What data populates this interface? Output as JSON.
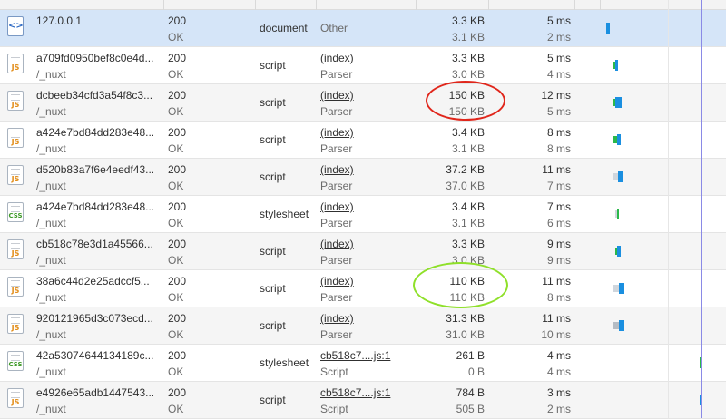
{
  "colors": {
    "selected_row": "#d5e5f8",
    "bar_blue": "#1a8fe0",
    "bar_green": "#2bb84a",
    "red_annotation": "#e0261b",
    "green_annotation": "#8fe02a"
  },
  "rows": [
    {
      "icon": "html-document-icon",
      "type_label": "<>",
      "name": "127.0.0.1",
      "path": "",
      "status": "200",
      "status_text": "OK",
      "type": "document",
      "initiator": "Other",
      "initiator_link": false,
      "initiator_sub": "",
      "size": "3.3 KB",
      "content": "3.1 KB",
      "time": "5 ms",
      "latency": "2 ms"
    },
    {
      "icon": "js-file-icon",
      "type_label": "JS",
      "name": "a709fd0950bef8c0e4d...",
      "path": "/_nuxt",
      "status": "200",
      "status_text": "OK",
      "type": "script",
      "initiator": "(index)",
      "initiator_link": true,
      "initiator_sub": "Parser",
      "size": "3.3 KB",
      "content": "3.0 KB",
      "time": "5 ms",
      "latency": "4 ms"
    },
    {
      "icon": "js-file-icon",
      "type_label": "JS",
      "name": "dcbeeb34cfd3a54f8c3...",
      "path": "/_nuxt",
      "status": "200",
      "status_text": "OK",
      "type": "script",
      "initiator": "(index)",
      "initiator_link": true,
      "initiator_sub": "Parser",
      "size": "150 KB",
      "content": "150 KB",
      "time": "12 ms",
      "latency": "5 ms"
    },
    {
      "icon": "js-file-icon",
      "type_label": "JS",
      "name": "a424e7bd84dd283e48...",
      "path": "/_nuxt",
      "status": "200",
      "status_text": "OK",
      "type": "script",
      "initiator": "(index)",
      "initiator_link": true,
      "initiator_sub": "Parser",
      "size": "3.4 KB",
      "content": "3.1 KB",
      "time": "8 ms",
      "latency": "8 ms"
    },
    {
      "icon": "js-file-icon",
      "type_label": "JS",
      "name": "d520b83a7f6e4eedf43...",
      "path": "/_nuxt",
      "status": "200",
      "status_text": "OK",
      "type": "script",
      "initiator": "(index)",
      "initiator_link": true,
      "initiator_sub": "Parser",
      "size": "37.2 KB",
      "content": "37.0 KB",
      "time": "11 ms",
      "latency": "7 ms"
    },
    {
      "icon": "css-file-icon",
      "type_label": "CSS",
      "name": "a424e7bd84dd283e48...",
      "path": "/_nuxt",
      "status": "200",
      "status_text": "OK",
      "type": "stylesheet",
      "initiator": "(index)",
      "initiator_link": true,
      "initiator_sub": "Parser",
      "size": "3.4 KB",
      "content": "3.1 KB",
      "time": "7 ms",
      "latency": "6 ms"
    },
    {
      "icon": "js-file-icon",
      "type_label": "JS",
      "name": "cb518c78e3d1a45566...",
      "path": "/_nuxt",
      "status": "200",
      "status_text": "OK",
      "type": "script",
      "initiator": "(index)",
      "initiator_link": true,
      "initiator_sub": "Parser",
      "size": "3.3 KB",
      "content": "3.0 KB",
      "time": "9 ms",
      "latency": "9 ms"
    },
    {
      "icon": "js-file-icon",
      "type_label": "JS",
      "name": "38a6c44d2e25adccf5...",
      "path": "/_nuxt",
      "status": "200",
      "status_text": "OK",
      "type": "script",
      "initiator": "(index)",
      "initiator_link": true,
      "initiator_sub": "Parser",
      "size": "110 KB",
      "content": "110 KB",
      "time": "11 ms",
      "latency": "8 ms"
    },
    {
      "icon": "js-file-icon",
      "type_label": "JS",
      "name": "920121965d3c073ecd...",
      "path": "/_nuxt",
      "status": "200",
      "status_text": "OK",
      "type": "script",
      "initiator": "(index)",
      "initiator_link": true,
      "initiator_sub": "Parser",
      "size": "31.3 KB",
      "content": "31.0 KB",
      "time": "11 ms",
      "latency": "10 ms"
    },
    {
      "icon": "css-file-icon",
      "type_label": "CSS",
      "name": "42a53074644134189c...",
      "path": "/_nuxt",
      "status": "200",
      "status_text": "OK",
      "type": "stylesheet",
      "initiator": "cb518c7....js:1",
      "initiator_link": true,
      "initiator_sub": "Script",
      "size": "261 B",
      "content": "0 B",
      "time": "4 ms",
      "latency": "4 ms"
    },
    {
      "icon": "js-file-icon",
      "type_label": "JS",
      "name": "e4926e65adb1447543...",
      "path": "/_nuxt",
      "status": "200",
      "status_text": "OK",
      "type": "script",
      "initiator": "cb518c7....js:1",
      "initiator_link": true,
      "initiator_sub": "Script",
      "size": "784 B",
      "content": "505 B",
      "time": "3 ms",
      "latency": "2 ms"
    }
  ]
}
